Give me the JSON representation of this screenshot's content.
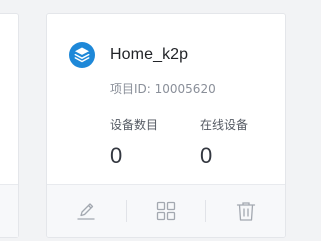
{
  "project": {
    "name": "Home_k2p",
    "id_text": "项目ID: 10005620",
    "icon": "layers-icon"
  },
  "stats": {
    "devices_label": "设备数目",
    "devices_value": "0",
    "online_label": "在线设备",
    "online_value": "0"
  },
  "actions": [
    {
      "name": "edit",
      "icon": "pencil-icon"
    },
    {
      "name": "view",
      "icon": "grid-icon"
    },
    {
      "name": "delete",
      "icon": "trash-icon"
    }
  ],
  "colors": {
    "accent": "#1e88d8",
    "icon_gray": "#a3a8b0",
    "background": "#f2f3f5",
    "card": "#ffffff"
  }
}
